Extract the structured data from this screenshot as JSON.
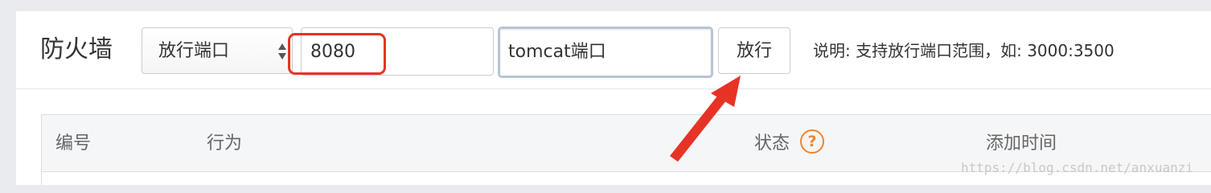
{
  "header": {
    "title": "防火墙"
  },
  "toolbar": {
    "action_select": {
      "value": "放行端口",
      "icon": "select-updown-arrows-icon"
    },
    "port_input": {
      "value": "8080"
    },
    "desc_input": {
      "value": "tomcat端口"
    },
    "allow_button_label": "放行",
    "hint": "说明: 支持放行端口范围，如: 3000:3500"
  },
  "table": {
    "columns": [
      {
        "label": "编号"
      },
      {
        "label": "行为"
      },
      {
        "label": "状态",
        "help_icon": "question-mark-icon",
        "help_glyph": "?"
      },
      {
        "label": "添加时间"
      }
    ]
  },
  "annotations": {
    "highlight_color": "#e63325",
    "arrow_color": "#e63325"
  },
  "watermark": "https://blog.csdn.net/anxuanzi"
}
